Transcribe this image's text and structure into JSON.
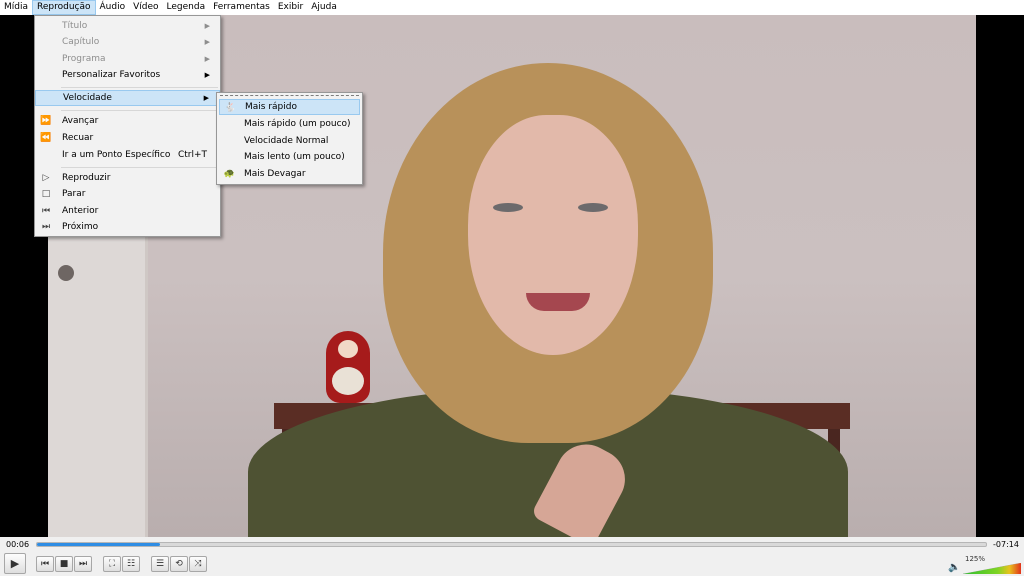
{
  "menubar": {
    "items": [
      {
        "label": "Mídia"
      },
      {
        "label": "Reprodução"
      },
      {
        "label": "Áudio"
      },
      {
        "label": "Vídeo"
      },
      {
        "label": "Legenda"
      },
      {
        "label": "Ferramentas"
      },
      {
        "label": "Exibir"
      },
      {
        "label": "Ajuda"
      }
    ]
  },
  "playback_menu": {
    "items": [
      {
        "label": "Título",
        "disabled": true,
        "submenu": true
      },
      {
        "label": "Capítulo",
        "disabled": true,
        "submenu": true
      },
      {
        "label": "Programa",
        "disabled": true,
        "submenu": true
      },
      {
        "label": "Personalizar Favoritos",
        "submenu": true
      },
      {
        "label": "Velocidade",
        "submenu": true,
        "highlighted": true
      },
      {
        "label": "Avançar",
        "icon": "fast-forward-icon"
      },
      {
        "label": "Recuar",
        "icon": "rewind-icon"
      },
      {
        "label": "Ir a um Ponto Específico",
        "shortcut": "Ctrl+T"
      },
      {
        "label": "Reproduzir",
        "icon": "play-icon"
      },
      {
        "label": "Parar",
        "icon": "stop-icon"
      },
      {
        "label": "Anterior",
        "icon": "previous-icon"
      },
      {
        "label": "Próximo",
        "icon": "next-icon"
      }
    ]
  },
  "speed_menu": {
    "items": [
      {
        "label": "Mais rápido",
        "icon": "rabbit-icon",
        "highlighted": true
      },
      {
        "label": "Mais rápido (um pouco)"
      },
      {
        "label": "Velocidade Normal"
      },
      {
        "label": "Mais lento (um pouco)"
      },
      {
        "label": "Mais Devagar",
        "icon": "turtle-icon"
      }
    ]
  },
  "controls": {
    "elapsed": "00:06",
    "remaining": "-07:14",
    "progress": 0.013,
    "volume_label": "125%",
    "volume": 1.25,
    "accent": "#2f8de4"
  }
}
